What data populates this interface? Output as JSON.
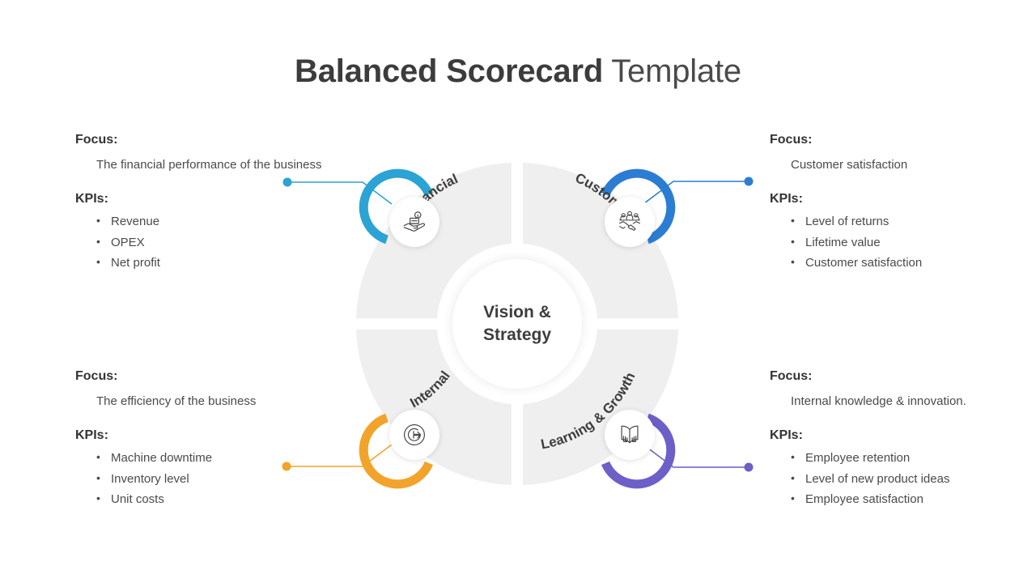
{
  "title": {
    "bold": "Balanced Scorecard",
    "light": " Template"
  },
  "center": {
    "line1": "Vision &",
    "line2": "Strategy"
  },
  "labels": {
    "focus": "Focus:",
    "kpis": "KPIs:"
  },
  "colors": {
    "financial": "#2BA3D4",
    "customer": "#2B7DD4",
    "internal": "#F2A32A",
    "learning": "#6C5FC7",
    "quadrant": "#EFEFEF",
    "text_dark": "#3d3d3d",
    "text_body": "#4a4a4a"
  },
  "quadrants": [
    {
      "id": "financial",
      "label": "Financial",
      "icon": "hand-money-icon",
      "color": "#2BA3D4"
    },
    {
      "id": "customer",
      "label": "Customer",
      "icon": "handshake-people-icon",
      "color": "#2B7DD4"
    },
    {
      "id": "internal",
      "label": "Internal",
      "icon": "process-cycle-icon",
      "color": "#F2A32A"
    },
    {
      "id": "learning",
      "label": "Learning & Growth",
      "icon": "open-book-icon",
      "color": "#6C5FC7"
    }
  ],
  "panels": {
    "financial": {
      "focus_label": "Focus:",
      "focus_text": "The financial performance of the business",
      "kpis_label": "KPIs:",
      "kpis": [
        "Revenue",
        "OPEX",
        "Net profit"
      ]
    },
    "customer": {
      "focus_label": "Focus:",
      "focus_text": "Customer satisfaction",
      "kpis_label": "KPIs:",
      "kpis": [
        "Level of returns",
        "Lifetime value",
        "Customer satisfaction"
      ]
    },
    "internal": {
      "focus_label": "Focus:",
      "focus_text": "The efficiency of the business",
      "kpis_label": "KPIs:",
      "kpis": [
        "Machine downtime",
        "Inventory level",
        "Unit costs"
      ]
    },
    "learning": {
      "focus_label": "Focus:",
      "focus_text": "Internal knowledge & innovation.",
      "kpis_label": "KPIs:",
      "kpis": [
        "Employee retention",
        "Level of new product ideas",
        "Employee satisfaction"
      ]
    }
  }
}
